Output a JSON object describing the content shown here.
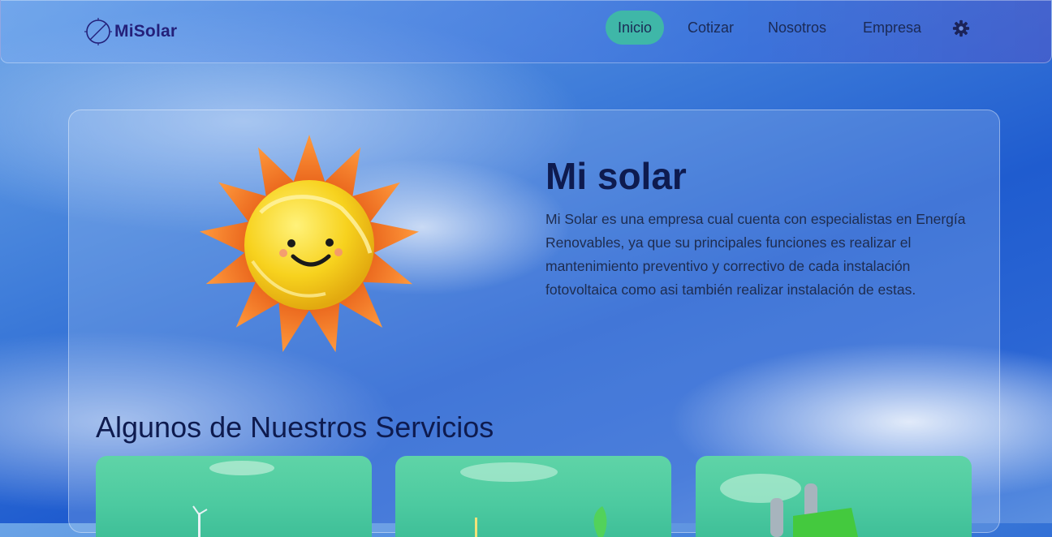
{
  "brand": {
    "logo_text": "MiSolar"
  },
  "nav": {
    "items": [
      {
        "label": "Inicio",
        "active": true
      },
      {
        "label": "Cotizar"
      },
      {
        "label": "Nosotros"
      },
      {
        "label": "Empresa"
      }
    ],
    "theme_toggle_icon": "gear-icon"
  },
  "hero": {
    "title": "Mi solar",
    "description": "Mi Solar es una empresa cual cuenta con especialistas en Energía Renovables, ya que su principales funciones es realizar el mantenimiento preventivo y correctivo de cada instalación fotovoltaica como asi también realizar instalación de estas.",
    "illustration_icon": "smiling-sun-icon"
  },
  "services": {
    "title": "Algunos de Nuestros Servicios",
    "cards": [
      {
        "icon": "wind-turbine-icon"
      },
      {
        "icon": "leaf-icon"
      },
      {
        "icon": "power-plug-icon"
      }
    ]
  },
  "colors": {
    "accent": "#3fb7a8",
    "brand_text": "#24207a",
    "heading": "#0e1b4f",
    "service_card": "#4ccaa0"
  }
}
